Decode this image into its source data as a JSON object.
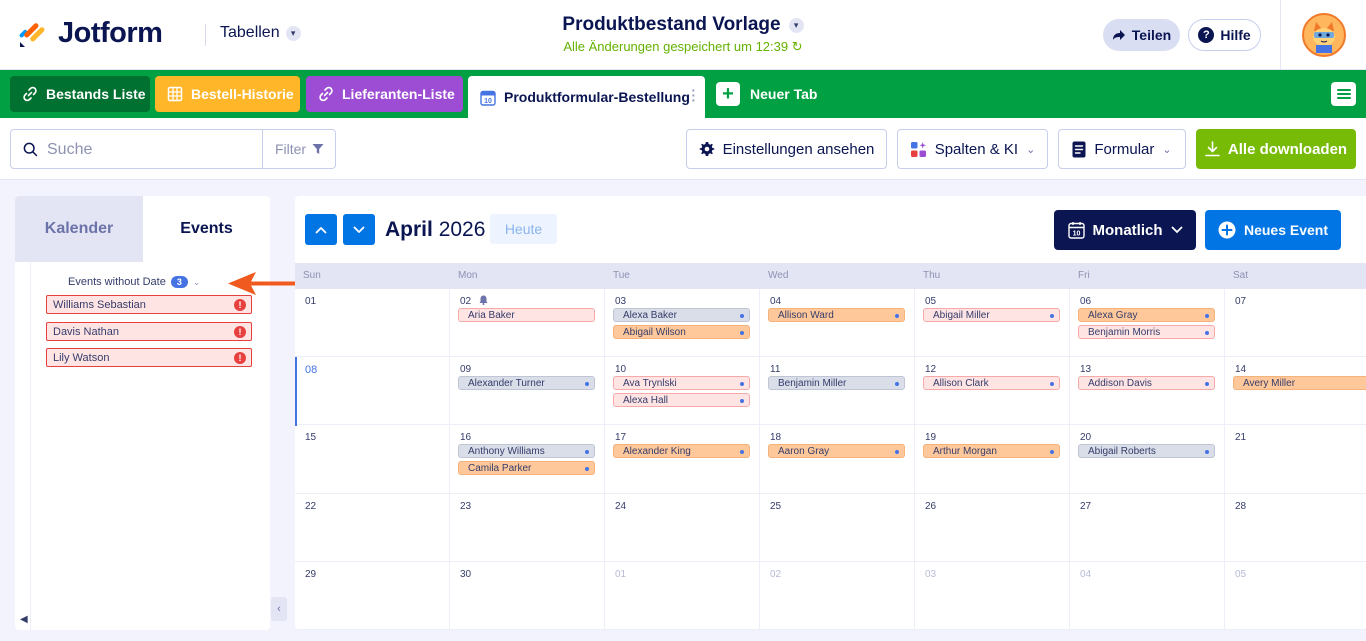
{
  "app": {
    "logo_text": "Jotform",
    "section": "Tabellen",
    "doc_title": "Produktbestand Vorlage",
    "save_status": "Alle Änderungen gespeichert um 12:39"
  },
  "header": {
    "share_label": "Teilen",
    "help_label": "Hilfe"
  },
  "tabs": [
    {
      "label": "Bestands Liste",
      "color": "#007130",
      "icon": "link-icon"
    },
    {
      "label": "Bestell-Historie",
      "color": "#ffb629",
      "icon": "grid-icon"
    },
    {
      "label": "Lieferanten-Liste",
      "color": "#9c4dd3",
      "icon": "link-icon"
    },
    {
      "label": "Produktformular-Bestellung",
      "active": true,
      "icon": "calendar-icon"
    }
  ],
  "new_tab_label": "Neuer Tab",
  "toolbar": {
    "search_placeholder": "Suche",
    "filter_label": "Filter",
    "settings_label": "Einstellungen ansehen",
    "columns_label": "Spalten & KI",
    "form_label": "Formular",
    "download_label": "Alle downloaden"
  },
  "sidebar": {
    "tab_calendar": "Kalender",
    "tab_events": "Events",
    "events_without_date_label": "Events without Date",
    "events_without_date_count": "3",
    "undated_events": [
      "Williams Sebastian",
      "Davis Nathan",
      "Lily Watson"
    ]
  },
  "calendar": {
    "month": "April",
    "year": "2026",
    "today_label": "Heute",
    "view_label": "Monatlich",
    "new_event_label": "Neues Event",
    "weekdays": [
      "Sun",
      "Mon",
      "Tue",
      "Wed",
      "Thu",
      "Fri",
      "Sat"
    ],
    "weeks": [
      [
        {
          "day": "01",
          "events": []
        },
        {
          "day": "02",
          "bell": true,
          "events": [
            {
              "name": "Aria Baker",
              "color": "red",
              "dot": false
            }
          ]
        },
        {
          "day": "03",
          "events": [
            {
              "name": "Alexa Baker",
              "color": "gray",
              "dot": true
            },
            {
              "name": "Abigail Wilson",
              "color": "orange",
              "dot": true
            }
          ]
        },
        {
          "day": "04",
          "events": [
            {
              "name": "Allison Ward",
              "color": "orange",
              "dot": true
            }
          ]
        },
        {
          "day": "05",
          "events": [
            {
              "name": "Abigail Miller",
              "color": "red",
              "dot": true
            }
          ]
        },
        {
          "day": "06",
          "events": [
            {
              "name": "Alexa Gray",
              "color": "orange",
              "dot": true
            },
            {
              "name": "Benjamin Morris",
              "color": "red",
              "dot": true
            }
          ]
        },
        {
          "day": "07",
          "events": []
        }
      ],
      [
        {
          "day": "08",
          "today": true,
          "events": []
        },
        {
          "day": "09",
          "events": [
            {
              "name": "Alexander Turner",
              "color": "gray",
              "dot": true
            }
          ]
        },
        {
          "day": "10",
          "events": [
            {
              "name": "Ava Trynlski",
              "color": "red",
              "dot": true
            },
            {
              "name": "Alexa Hall",
              "color": "red",
              "dot": true
            }
          ]
        },
        {
          "day": "11",
          "events": [
            {
              "name": "Benjamin Miller",
              "color": "gray",
              "dot": true
            }
          ]
        },
        {
          "day": "12",
          "events": [
            {
              "name": "Allison Clark",
              "color": "red",
              "dot": true
            }
          ]
        },
        {
          "day": "13",
          "events": [
            {
              "name": "Addison Davis",
              "color": "red",
              "dot": true
            }
          ]
        },
        {
          "day": "14",
          "events": [
            {
              "name": "Avery Miller",
              "color": "orange",
              "dot": false
            }
          ]
        }
      ],
      [
        {
          "day": "15",
          "events": []
        },
        {
          "day": "16",
          "events": [
            {
              "name": "Anthony Williams",
              "color": "gray",
              "dot": true
            },
            {
              "name": "Camila Parker",
              "color": "orange",
              "dot": true
            }
          ]
        },
        {
          "day": "17",
          "events": [
            {
              "name": "Alexander King",
              "color": "orange",
              "dot": true
            }
          ]
        },
        {
          "day": "18",
          "events": [
            {
              "name": "Aaron Gray",
              "color": "orange",
              "dot": true
            }
          ]
        },
        {
          "day": "19",
          "events": [
            {
              "name": "Arthur Morgan",
              "color": "orange",
              "dot": true
            }
          ]
        },
        {
          "day": "20",
          "events": [
            {
              "name": "Abigail Roberts",
              "color": "gray",
              "dot": true
            }
          ]
        },
        {
          "day": "21",
          "events": []
        }
      ],
      [
        {
          "day": "22",
          "events": []
        },
        {
          "day": "23",
          "events": []
        },
        {
          "day": "24",
          "events": []
        },
        {
          "day": "25",
          "events": []
        },
        {
          "day": "26",
          "events": []
        },
        {
          "day": "27",
          "events": []
        },
        {
          "day": "28",
          "events": []
        }
      ],
      [
        {
          "day": "29",
          "events": []
        },
        {
          "day": "30",
          "events": []
        },
        {
          "day": "01",
          "muted": true,
          "events": []
        },
        {
          "day": "02",
          "muted": true,
          "events": []
        },
        {
          "day": "03",
          "muted": true,
          "events": []
        },
        {
          "day": "04",
          "muted": true,
          "events": []
        },
        {
          "day": "05",
          "muted": true,
          "events": []
        }
      ]
    ]
  },
  "colors": {
    "brand_green": "#01a143",
    "navy": "#0a1551",
    "blue": "#0075e3",
    "download_green": "#78bb07",
    "annotation_arrow": "#f05a1e"
  }
}
